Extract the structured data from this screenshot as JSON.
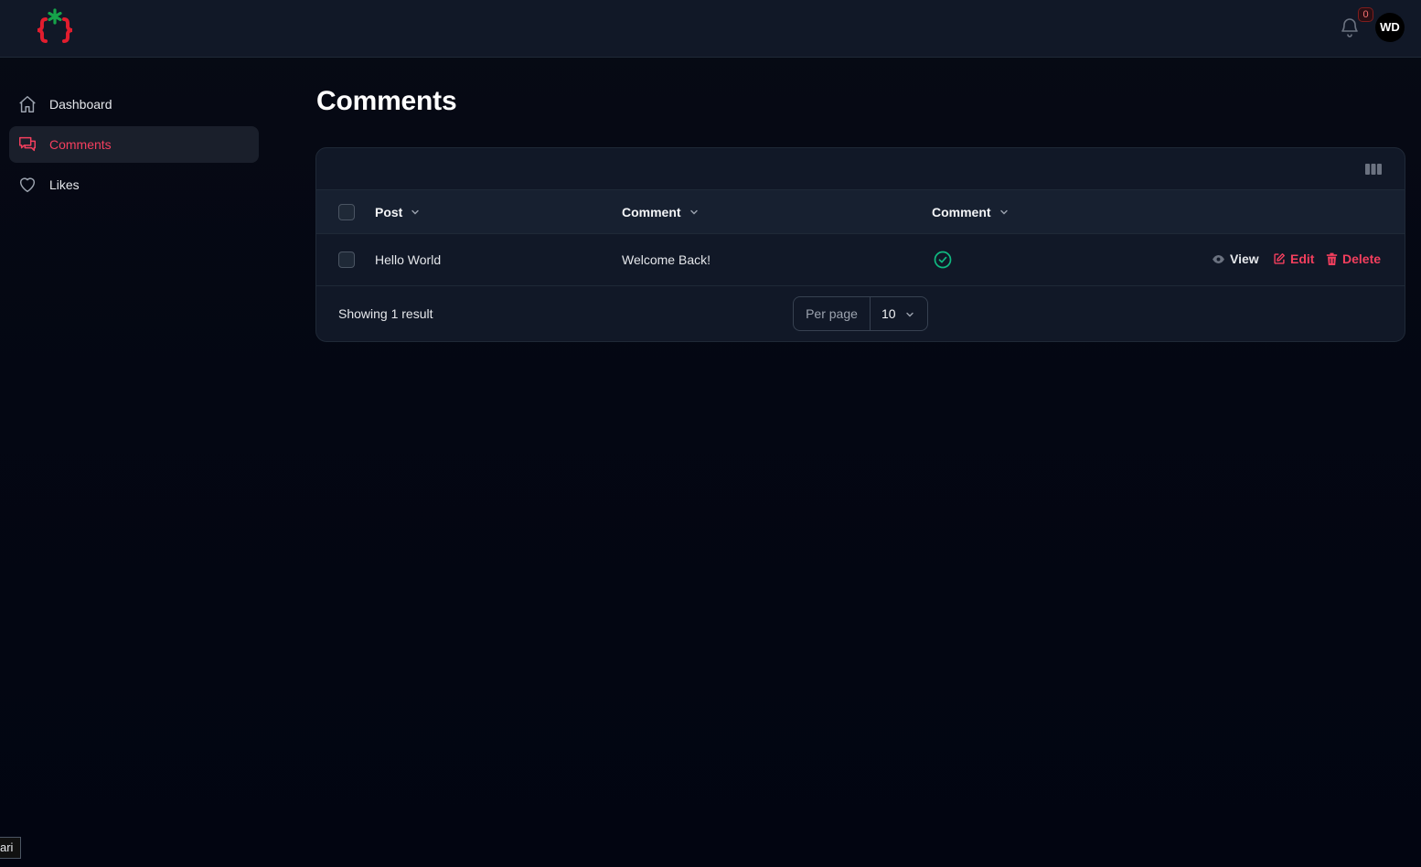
{
  "topbar": {
    "notification_count": "0",
    "user_initials": "WD"
  },
  "sidebar": {
    "items": [
      {
        "label": "Dashboard",
        "icon": "home-icon",
        "active": false
      },
      {
        "label": "Comments",
        "icon": "chat-bubbles-icon",
        "active": true
      },
      {
        "label": "Likes",
        "icon": "heart-icon",
        "active": false
      }
    ]
  },
  "page": {
    "title": "Comments"
  },
  "table": {
    "headers": [
      "Post",
      "Comment",
      "Comment"
    ],
    "rows": [
      {
        "post": "Hello World",
        "comment": "Welcome Back!",
        "approved": true,
        "actions": [
          "View",
          "Edit",
          "Delete"
        ]
      }
    ],
    "footer": {
      "showing": "Showing 1 result",
      "per_page_label": "Per page",
      "per_page_value": "10"
    }
  },
  "tooltip": {
    "text": "ari"
  },
  "colors": {
    "accent": "#f43f5e",
    "success": "#10b981",
    "surface": "#111827",
    "background": "#030712"
  }
}
